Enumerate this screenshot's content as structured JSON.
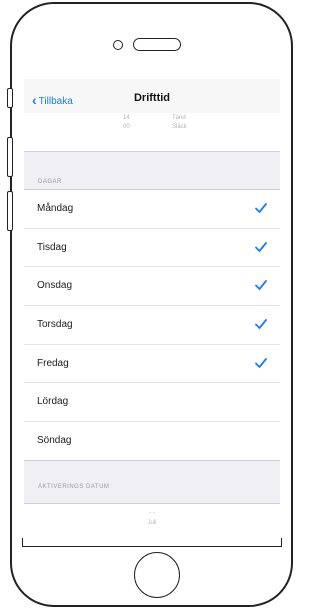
{
  "nav": {
    "back_label": "Tillbaka",
    "title": "Drifttid"
  },
  "picker_top": {
    "left_top": "14",
    "left_bottom": "00",
    "right_top": "Tänd",
    "right_bottom": "Släck"
  },
  "days_section": {
    "header": "DAGAR",
    "days": [
      {
        "label": "Måndag",
        "checked": true
      },
      {
        "label": "Tisdag",
        "checked": true
      },
      {
        "label": "Onsdag",
        "checked": true
      },
      {
        "label": "Torsdag",
        "checked": true
      },
      {
        "label": "Fredag",
        "checked": true
      },
      {
        "label": "Lördag",
        "checked": false
      },
      {
        "label": "Söndag",
        "checked": false
      }
    ]
  },
  "dates_section": {
    "header": "AKTIVERINGS DATUM"
  },
  "picker_bottom": {
    "top": "- -",
    "bottom": "Juli"
  },
  "colors": {
    "accent": "#1e7ee6",
    "background": "#efeff4"
  }
}
